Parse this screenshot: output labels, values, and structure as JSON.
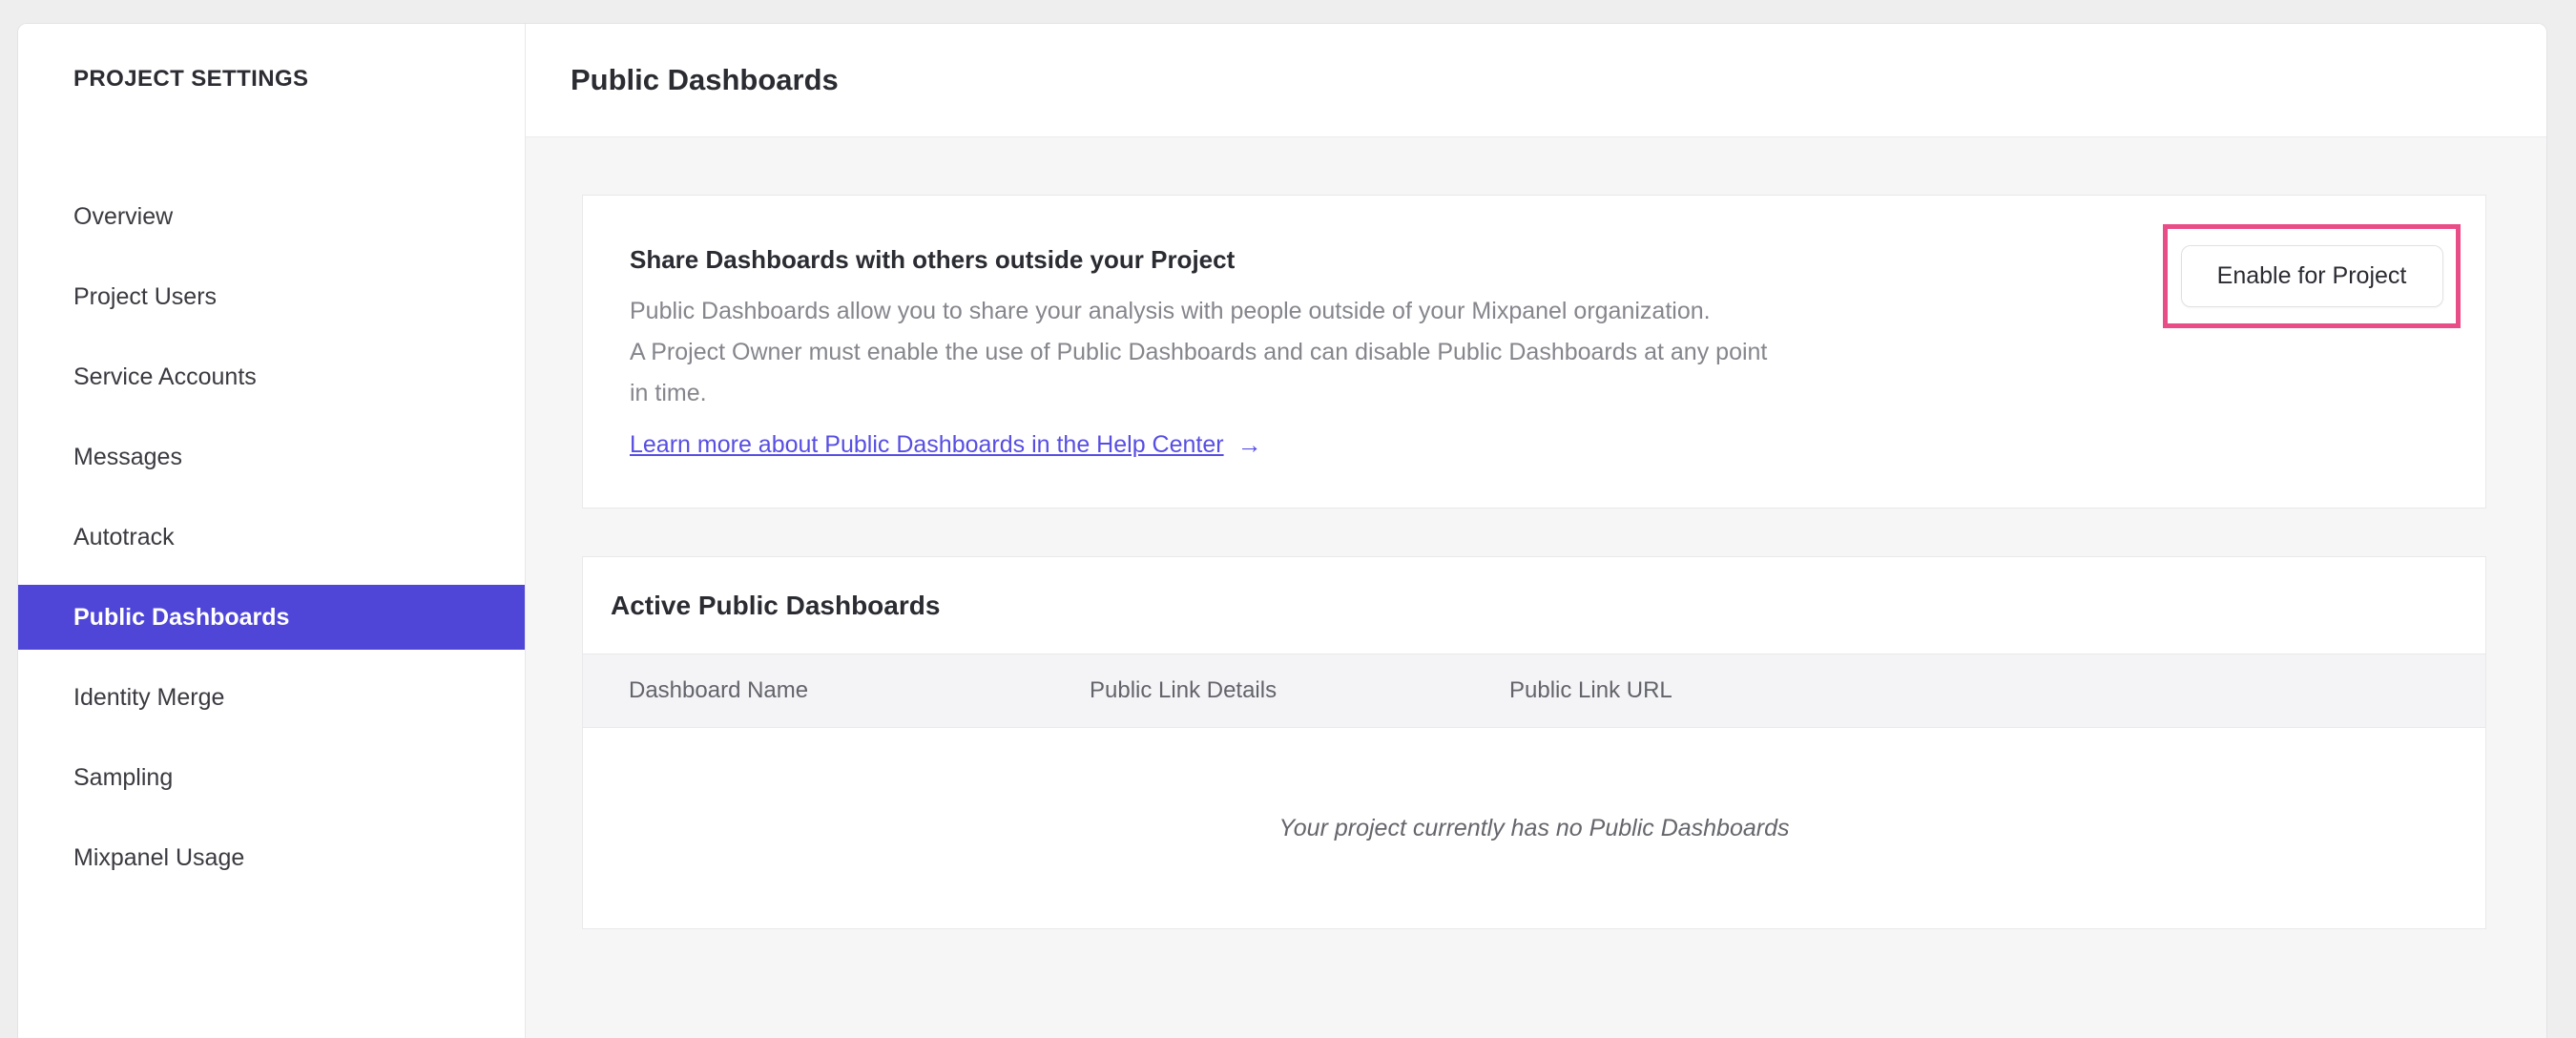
{
  "sidebar": {
    "title": "PROJECT SETTINGS",
    "items": [
      {
        "label": "Overview",
        "selected": false
      },
      {
        "label": "Project Users",
        "selected": false
      },
      {
        "label": "Service Accounts",
        "selected": false
      },
      {
        "label": "Messages",
        "selected": false
      },
      {
        "label": "Autotrack",
        "selected": false
      },
      {
        "label": "Public Dashboards",
        "selected": true
      },
      {
        "label": "Identity Merge",
        "selected": false
      },
      {
        "label": "Sampling",
        "selected": false
      },
      {
        "label": "Mixpanel Usage",
        "selected": false
      }
    ]
  },
  "header": {
    "title": "Public Dashboards"
  },
  "share_card": {
    "heading": "Share Dashboards with others outside your Project",
    "body_lines": [
      "Public Dashboards allow you to share your analysis with people outside of your Mixpanel organization.",
      "A Project Owner must enable the use of Public Dashboards and can disable Public Dashboards at any point",
      "in time."
    ],
    "link_label": "Learn more about Public Dashboards in the Help Center",
    "link_arrow": "→",
    "button_label": "Enable for Project"
  },
  "active_card": {
    "title": "Active Public Dashboards",
    "columns": [
      "Dashboard Name",
      "Public Link Details",
      "Public Link URL"
    ],
    "empty_message": "Your project currently has no Public Dashboards"
  },
  "colors": {
    "accent_purple": "#4f46d8",
    "annotation_pink": "#e94d87",
    "link_purple": "#574ee2",
    "content_background": "#f6f6f7",
    "outer_background": "#eeeeef"
  }
}
